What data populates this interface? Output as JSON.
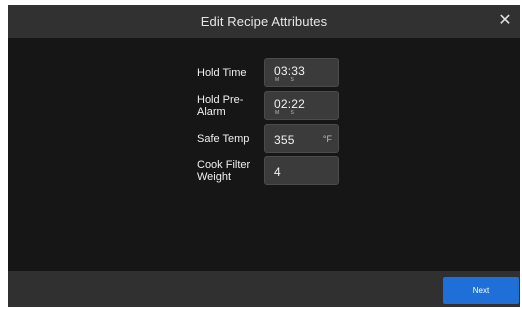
{
  "header": {
    "title": "Edit Recipe Attributes",
    "close_icon": "close-icon"
  },
  "form": {
    "hold_time": {
      "label": "Hold Time",
      "value": "03:33",
      "units": "M S"
    },
    "hold_pre_alarm": {
      "label": "Hold Pre-Alarm",
      "value": "02:22",
      "units": "M S"
    },
    "safe_temp": {
      "label": "Safe Temp",
      "value": "355",
      "unit": "°F"
    },
    "cook_filter_weight": {
      "label": "Cook Filter Weight",
      "value": "4"
    }
  },
  "footer": {
    "next_label": "Next",
    "next_color": "#1f6fd9"
  }
}
